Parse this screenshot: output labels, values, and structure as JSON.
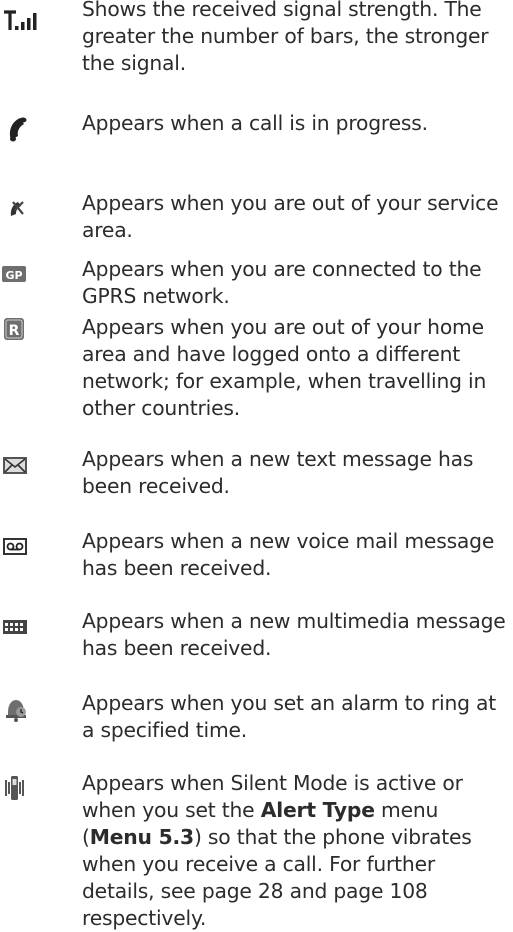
{
  "entries": [
    {
      "icon": "signal-strength-icon",
      "text": "Shows the received signal strength. The greater the number of bars, the stronger the signal."
    },
    {
      "icon": "call-in-progress-icon",
      "text": "Appears when a call is in progress."
    },
    {
      "icon": "no-service-icon",
      "text": "Appears when you are out of your service area."
    },
    {
      "icon": "gprs-icon",
      "text": "Appears when you are connected to the GPRS network."
    },
    {
      "icon": "roaming-icon",
      "text": "Appears when you are out of your home area and have logged onto a different network; for example, when travelling in other countries."
    },
    {
      "icon": "text-message-icon",
      "text": "Appears when a new text message has been received."
    },
    {
      "icon": "voice-mail-icon",
      "text": "Appears when a new voice mail message has been received."
    },
    {
      "icon": "multimedia-message-icon",
      "text": "Appears when a new multimedia message has been received."
    },
    {
      "icon": "alarm-icon",
      "text": "Appears when you set an alarm to ring at a specified time."
    },
    {
      "icon": "vibrate-silent-icon",
      "text_parts": {
        "p1": "Appears when Silent Mode is active or when you set the ",
        "b1": "Alert Type",
        "p2": " menu (",
        "b2": "Menu 5.3",
        "p3": ") so that the phone vibrates when you receive a call. For further details, see page 28 and page 108 respectively."
      }
    }
  ],
  "icon_labels": {
    "gprs": "GP",
    "roaming": "R"
  },
  "colors": {
    "text": "#2c2c2c",
    "icon_dark": "#222222",
    "icon_gray": "#6e6e6e"
  }
}
